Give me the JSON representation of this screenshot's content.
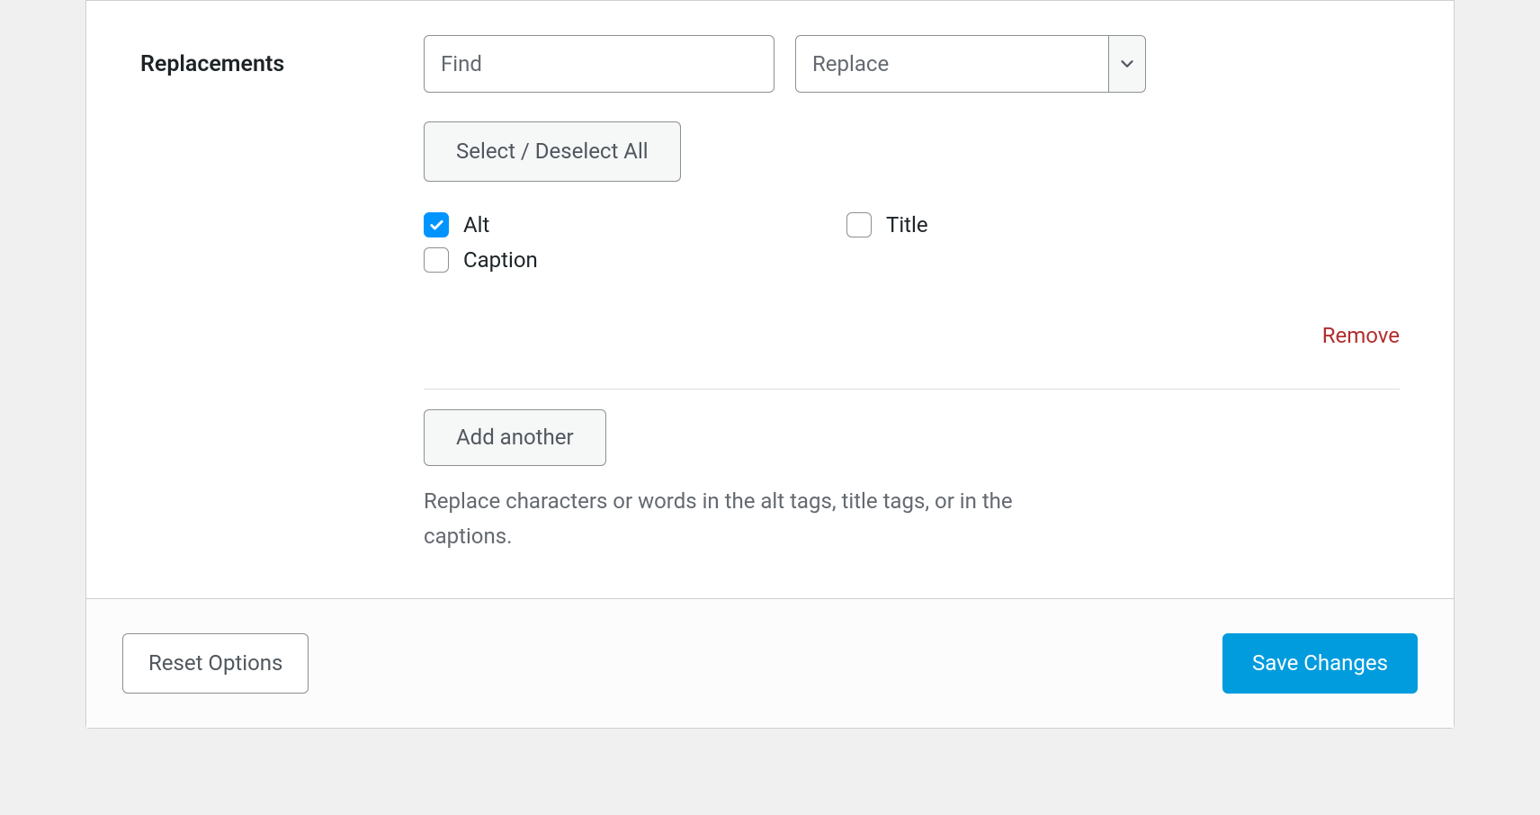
{
  "replacements": {
    "label": "Replacements",
    "find_placeholder": "Find",
    "replace_placeholder": "Replace",
    "select_all_label": "Select / Deselect All",
    "checkboxes": {
      "alt": {
        "label": "Alt",
        "checked": true
      },
      "title": {
        "label": "Title",
        "checked": false
      },
      "caption": {
        "label": "Caption",
        "checked": false
      }
    },
    "remove_label": "Remove",
    "add_another_label": "Add another",
    "help_text": "Replace characters or words in the alt tags, title tags, or in the captions."
  },
  "footer": {
    "reset_label": "Reset Options",
    "save_label": "Save Changes"
  }
}
